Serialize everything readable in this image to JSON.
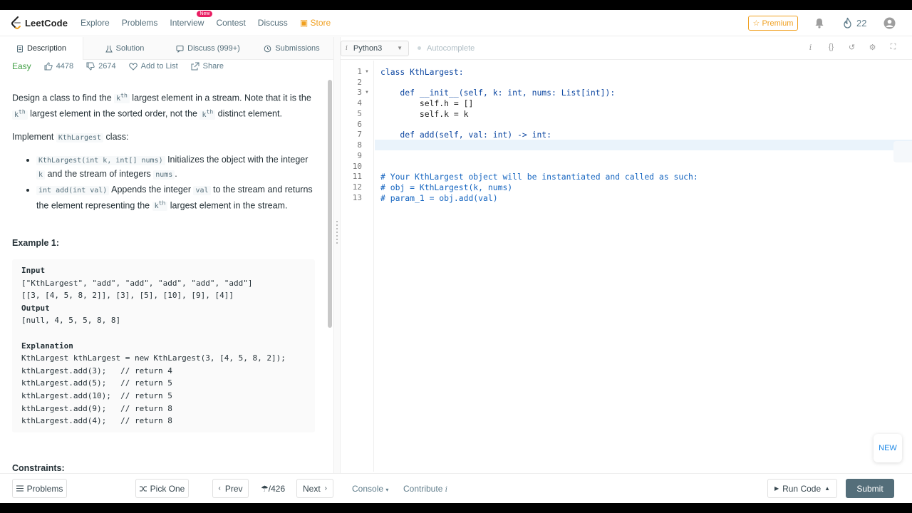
{
  "nav": {
    "brand": "LeetCode",
    "links": [
      "Explore",
      "Problems",
      "Interview",
      "Contest",
      "Discuss"
    ],
    "interview_badge": "New",
    "store": "Store",
    "premium": "Premium",
    "streak": "22"
  },
  "tabs": [
    "Description",
    "Solution",
    "Discuss (999+)",
    "Submissions"
  ],
  "problem": {
    "difficulty": "Easy",
    "likes": "4478",
    "dislikes": "2674",
    "add_to_list": "Add to List",
    "share": "Share",
    "desc1_a": "Design a class to find the ",
    "desc1_k": "k",
    "desc1_sup": "th",
    "desc1_b": " largest element in a stream. Note that it is the ",
    "desc1_k2": "k",
    "desc1_sup2": "th",
    "desc1_c": " largest element in the sorted order, not the ",
    "desc1_k3": "k",
    "desc1_sup3": "th",
    "desc1_d": " distinct element.",
    "impl_a": "Implement ",
    "impl_code": "KthLargest",
    "impl_b": " class:",
    "bullet1_code": "KthLargest(int k, int[] nums)",
    "bullet1_a": " Initializes the object with the integer ",
    "bullet1_k": "k",
    "bullet1_b": " and the stream of integers ",
    "bullet1_nums": "nums",
    "bullet1_c": ".",
    "bullet2_code": "int add(int val)",
    "bullet2_a": " Appends the integer ",
    "bullet2_val": "val",
    "bullet2_b": " to the stream and returns the element representing the ",
    "bullet2_k": "k",
    "bullet2_sup": "th",
    "bullet2_c": " largest element in the stream.",
    "example_title": "Example 1:",
    "example_input_label": "Input",
    "example_input_1": "[\"KthLargest\", \"add\", \"add\", \"add\", \"add\", \"add\"]",
    "example_input_2": "[[3, [4, 5, 8, 2]], [3], [5], [10], [9], [4]]",
    "example_output_label": "Output",
    "example_output": "[null, 4, 5, 5, 8, 8]",
    "example_expl_label": "Explanation",
    "example_expl": [
      "KthLargest kthLargest = new KthLargest(3, [4, 5, 8, 2]);",
      "kthLargest.add(3);   // return 4",
      "kthLargest.add(5);   // return 5",
      "kthLargest.add(10);  // return 5",
      "kthLargest.add(9);   // return 8",
      "kthLargest.add(4);   // return 8"
    ],
    "constraints_title": "Constraints:"
  },
  "editor": {
    "language": "Python3",
    "autocomplete": "Autocomplete",
    "line_numbers": [
      "1",
      "2",
      "3",
      "4",
      "5",
      "6",
      "7",
      "8",
      "9",
      "10",
      "11",
      "12",
      "13"
    ],
    "lines": [
      "class KthLargest:",
      "",
      "    def __init__(self, k: int, nums: List[int]):",
      "        self.h = []",
      "        self.k = k",
      "",
      "    def add(self, val: int) -> int:",
      "",
      "",
      "",
      "# Your KthLargest object will be instantiated and called as such:",
      "# obj = KthLargest(k, nums)",
      "# param_1 = obj.add(val)"
    ],
    "new_button": "NEW"
  },
  "footer": {
    "problems": "Problems",
    "pick_one": "Pick One",
    "prev": "Prev",
    "counter": "/426",
    "next": "Next",
    "console": "Console",
    "contribute": "Contribute",
    "run_code": "Run Code",
    "submit": "Submit"
  },
  "colors": {
    "easy": "#43a047",
    "store": "#f0a020",
    "submit_bg": "#546e7a",
    "current_line": "#eaf3fb"
  }
}
